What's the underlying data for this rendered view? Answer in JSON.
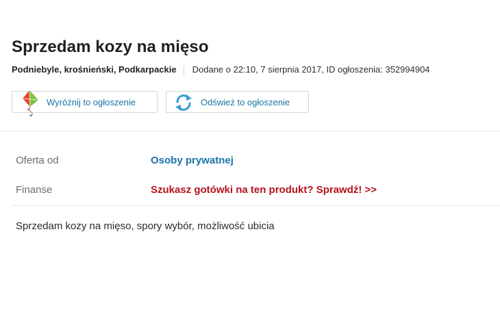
{
  "ad": {
    "title": "Sprzedam kozy na mięso",
    "location": "Podniebyle, krośnieński, Podkarpackie",
    "added_info": "Dodane o 22:10, 7 sierpnia 2017, ID ogłoszenia: 352994904"
  },
  "actions": {
    "highlight_label": "Wyróżnij to ogłoszenie",
    "refresh_label": "Odśwież to ogłoszenie"
  },
  "details": {
    "offer_key": "Oferta od",
    "offer_value": "Osoby prywatnej",
    "finance_key": "Finanse",
    "finance_value": "Szukasz gotówki na ten produkt? Sprawdź! >>"
  },
  "description": "Sprzedam kozy na mięso, spory wybór, możliwość ubicia",
  "icons": {
    "highlight": "kite-icon",
    "refresh": "refresh-icon"
  },
  "colors": {
    "link": "#1a74a6",
    "promo": "#b4121b"
  }
}
